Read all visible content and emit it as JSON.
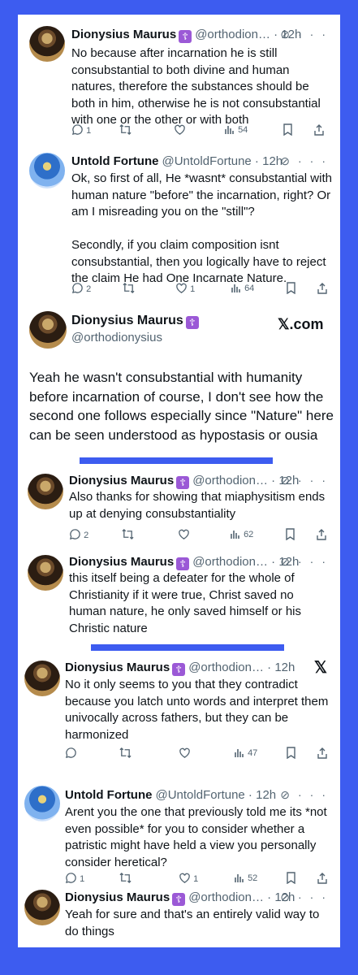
{
  "tweets": [
    {
      "name": "Dionysius Maurus",
      "badge": "☦",
      "handle": "@orthodion…",
      "time": "12h",
      "text": "No because after incarnation he is still consubstantial to both divine and human natures, therefore the substances should be both in him, otherwise he is not consubstantial with one or the other or with both",
      "replies": "1",
      "likes": "",
      "views": "54"
    },
    {
      "name": "Untold Fortune",
      "handle": "@UntoldFortune",
      "time": "12h",
      "text1": "Ok, so first of all, He *wasnt* consubstantial with human nature \"before\" the incarnation, right? Or am I misreading you on the \"still\"?",
      "text2": "Secondly, if you claim composition isnt consubstantial, then you logically have to reject the claim He had One Incarnate Nature.",
      "replies": "2",
      "likes": "1",
      "views": "64"
    },
    {
      "name": "Dionysius Maurus",
      "badge": "☦",
      "handle": "@orthodionysius",
      "site": "𝕏.com",
      "text": "Yeah he wasn't consubstantial with humanity before incarnation of course, I don't see how the second one follows especially since \"Nature\" here can be seen understood as hypostasis or ousia"
    },
    {
      "name": "Dionysius Maurus",
      "badge": "☦",
      "handle": "@orthodion…",
      "time": "12h",
      "text": "Also thanks for showing that miaphysitism ends up at denying consubstantiality",
      "replies": "2",
      "views": "62"
    },
    {
      "name": "Dionysius Maurus",
      "badge": "☦",
      "handle": "@orthodion…",
      "time": "12h",
      "text": "this itself being a defeater for the whole of Christianity if it were true, Christ saved no human nature, he only saved himself or his Christic nature"
    },
    {
      "name": "Dionysius Maurus",
      "badge": "☦",
      "handle": "@orthodion…",
      "time": "12h",
      "x_logo": "𝕏",
      "text": "No it only seems to you that they contradict because you latch unto words and interpret them univocally across fathers, but they can be harmonized",
      "views": "47"
    },
    {
      "name": "Untold Fortune",
      "handle": "@UntoldFortune",
      "time": "12h",
      "text": "Arent you the one that previously told me its *not even possible* for you to consider whether a patristic might have held a view you personally consider heretical?",
      "replies": "1",
      "likes": "1",
      "views": "52"
    },
    {
      "name": "Dionysius Maurus",
      "badge": "☦",
      "handle": "@orthodion…",
      "time": "12h",
      "text": "Yeah for sure and that's an entirely valid way to do things"
    }
  ],
  "icons": [
    "reply-icon",
    "retweet-icon",
    "like-icon",
    "views-icon",
    "bookmark-icon",
    "share-icon",
    "grok-icon",
    "more-icon",
    "cross-badge-icon"
  ],
  "colors": {
    "frame": "#3d5cf0",
    "text": "#0f1419",
    "muted": "#536471",
    "badge": "#9b59d6"
  }
}
